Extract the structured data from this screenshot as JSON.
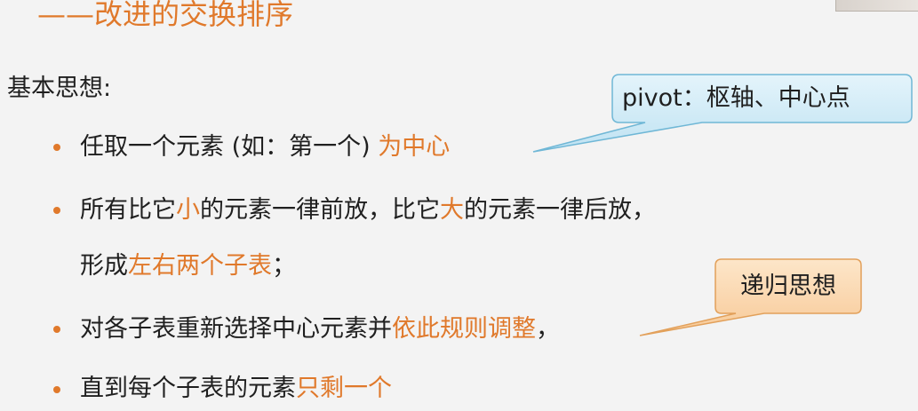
{
  "title": "——改进的交换排序",
  "heading": "基本思想:",
  "bullets": [
    {
      "parts": [
        "任取一个元素 (如：第一个) ",
        "为中心"
      ]
    },
    {
      "parts": [
        "所有比它",
        "小",
        "的元素一律前放，比它",
        "大",
        "的元素一律后放，"
      ]
    },
    {
      "parts": [
        "形成",
        "左右两个子表",
        "；"
      ]
    },
    {
      "parts": [
        "对各子表重新选择中心元素并",
        "依此规则调整",
        "，"
      ]
    },
    {
      "parts": [
        "直到每个子表的元素",
        "只剩一个"
      ]
    }
  ],
  "callouts": {
    "pivot": "pivot：枢轴、中心点",
    "recursion": "递归思想"
  },
  "colors": {
    "accent": "#e0792b",
    "callout_blue": "#cfeaf6",
    "callout_orange": "#fbd7ad"
  }
}
